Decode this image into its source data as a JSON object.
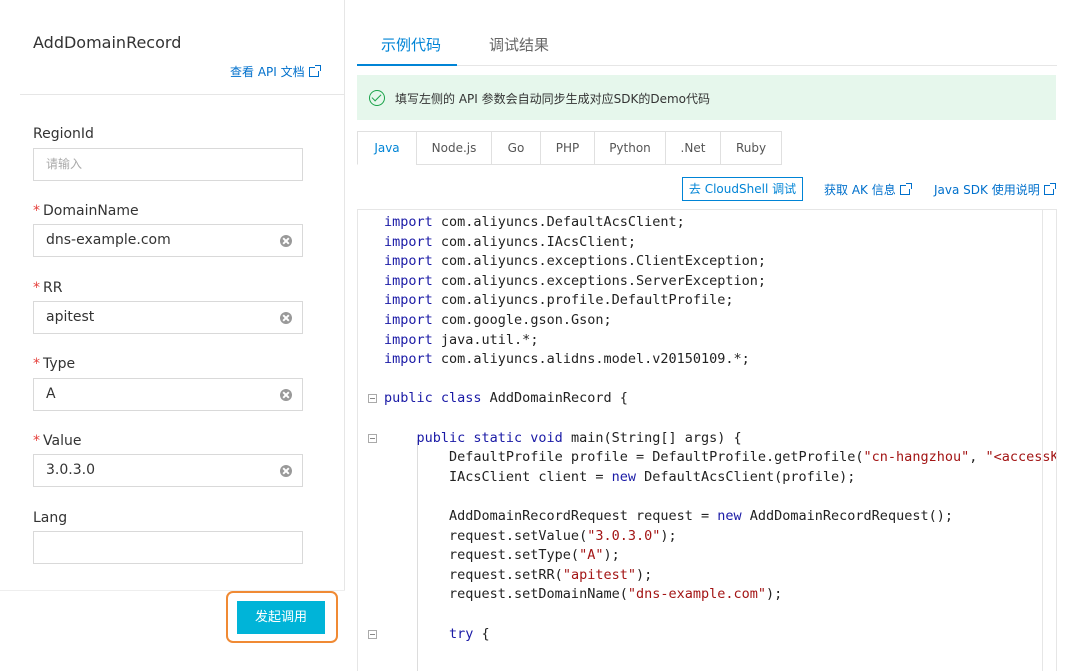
{
  "left": {
    "api_name": "AddDomainRecord",
    "doc_link": "查看 API 文档",
    "fields": [
      {
        "label": "RegionId",
        "required": false,
        "value": "",
        "placeholder": "请输入"
      },
      {
        "label": "DomainName",
        "required": true,
        "value": "dns-example.com"
      },
      {
        "label": "RR",
        "required": true,
        "value": "apitest"
      },
      {
        "label": "Type",
        "required": true,
        "value": "A"
      },
      {
        "label": "Value",
        "required": true,
        "value": "3.0.3.0"
      },
      {
        "label": "Lang",
        "required": false,
        "value": ""
      }
    ],
    "required_mark": "*",
    "submit_label": "发起调用"
  },
  "right": {
    "tabs": [
      {
        "label": "示例代码",
        "active": true
      },
      {
        "label": "调试结果",
        "active": false
      }
    ],
    "notice": "填写左侧的 API 参数会自动同步生成对应SDK的Demo代码",
    "languages": [
      "Java",
      "Node.js",
      "Go",
      "PHP",
      "Python",
      ".Net",
      "Ruby"
    ],
    "active_language": "Java",
    "cloudshell_label": "去 CloudShell 调试",
    "ak_link": "获取 AK 信息",
    "sdk_link": "Java SDK 使用说明",
    "code": [
      [
        [
          "kw",
          "import"
        ],
        [
          "",
          "com.aliyuncs.DefaultAcsClient;"
        ]
      ],
      [
        [
          "kw",
          "import"
        ],
        [
          "",
          "com.aliyuncs.IAcsClient;"
        ]
      ],
      [
        [
          "kw",
          "import"
        ],
        [
          "",
          "com.aliyuncs.exceptions.ClientException;"
        ]
      ],
      [
        [
          "kw",
          "import"
        ],
        [
          "",
          "com.aliyuncs.exceptions.ServerException;"
        ]
      ],
      [
        [
          "kw",
          "import"
        ],
        [
          "",
          "com.aliyuncs.profile.DefaultProfile;"
        ]
      ],
      [
        [
          "kw",
          "import"
        ],
        [
          "",
          "com.google.gson.Gson;"
        ]
      ],
      [
        [
          "kw",
          "import"
        ],
        [
          "",
          "java.util.*;"
        ]
      ],
      [
        [
          "kw",
          "import"
        ],
        [
          "",
          "com.aliyuncs.alidns.model.v20150109.*;"
        ]
      ],
      [],
      [
        [
          "kw",
          "public class"
        ],
        [
          "",
          "AddDomainRecord {"
        ]
      ],
      [],
      [
        [
          "kw",
          "    public static void"
        ],
        [
          "",
          "main(String[] args) {"
        ]
      ],
      [
        [
          "",
          "        DefaultProfile profile = DefaultProfile.getProfile("
        ],
        [
          "str",
          "\"cn-hangzhou\""
        ],
        [
          "",
          ", "
        ],
        [
          "str",
          "\"<accessKeyId>\""
        ]
      ],
      [
        [
          "",
          "        IAcsClient client = "
        ],
        [
          "kw",
          "new"
        ],
        [
          "",
          " DefaultAcsClient(profile);"
        ]
      ],
      [],
      [
        [
          "",
          "        AddDomainRecordRequest request = "
        ],
        [
          "kw",
          "new"
        ],
        [
          "",
          " AddDomainRecordRequest();"
        ]
      ],
      [
        [
          "",
          "        request.setValue("
        ],
        [
          "str",
          "\"3.0.3.0\""
        ],
        [
          "",
          ");"
        ]
      ],
      [
        [
          "",
          "        request.setType("
        ],
        [
          "str",
          "\"A\""
        ],
        [
          "",
          ");"
        ]
      ],
      [
        [
          "",
          "        request.setRR("
        ],
        [
          "str",
          "\"apitest\""
        ],
        [
          "",
          ");"
        ]
      ],
      [
        [
          "",
          "        request.setDomainName("
        ],
        [
          "str",
          "\"dns-example.com\""
        ],
        [
          "",
          ");"
        ]
      ],
      [],
      [
        [
          "kw",
          "        try"
        ],
        [
          "",
          " {"
        ]
      ]
    ]
  }
}
